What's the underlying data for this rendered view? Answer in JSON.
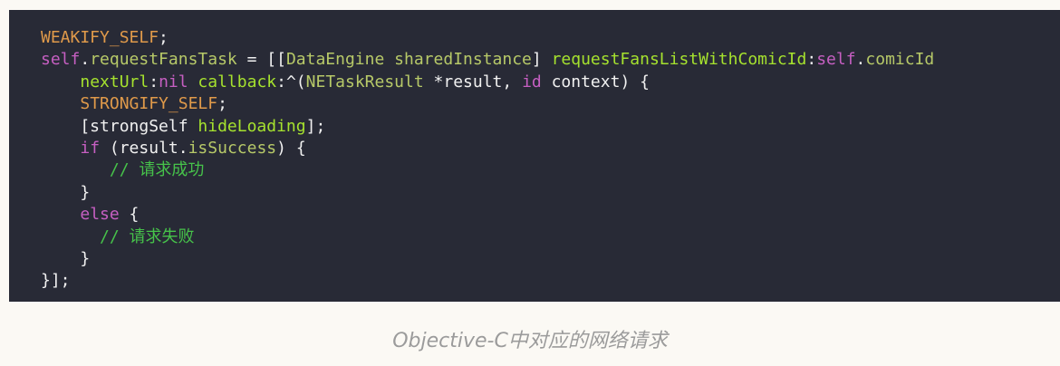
{
  "colors": {
    "background": "#282a36",
    "page": "#fbf9f4",
    "plain": "#f1f1f1",
    "macro": "#e09a4a",
    "keyword": "#c65fc2",
    "selector": "#a6e22e",
    "type": "#b7c968",
    "comment": "#46c24a",
    "caption": "#9b9b9b"
  },
  "code_lines": [
    {
      "tokens": [
        {
          "text": "WEAKIFY_SELF",
          "color": "#e09a4a"
        },
        {
          "text": ";",
          "color": "#f1f1f1"
        }
      ]
    },
    {
      "tokens": [
        {
          "text": "self",
          "color": "#c65fc2"
        },
        {
          "text": ".",
          "color": "#f1f1f1"
        },
        {
          "text": "requestFansTask",
          "color": "#b7c968"
        },
        {
          "text": " = [[",
          "color": "#f1f1f1"
        },
        {
          "text": "DataEngine",
          "color": "#b7c968"
        },
        {
          "text": " ",
          "color": "#f1f1f1"
        },
        {
          "text": "sharedInstance",
          "color": "#b7c968"
        },
        {
          "text": "] ",
          "color": "#f1f1f1"
        },
        {
          "text": "requestFansListWithComicId",
          "color": "#a6e22e"
        },
        {
          "text": ":",
          "color": "#f1f1f1"
        },
        {
          "text": "self",
          "color": "#c65fc2"
        },
        {
          "text": ".",
          "color": "#f1f1f1"
        },
        {
          "text": "comicId",
          "color": "#b7c968"
        }
      ]
    },
    {
      "tokens": [
        {
          "text": "    ",
          "color": "#f1f1f1"
        },
        {
          "text": "nextUrl",
          "color": "#a6e22e"
        },
        {
          "text": ":",
          "color": "#f1f1f1"
        },
        {
          "text": "nil",
          "color": "#c65fc2"
        },
        {
          "text": " ",
          "color": "#f1f1f1"
        },
        {
          "text": "callback",
          "color": "#a6e22e"
        },
        {
          "text": ":^(",
          "color": "#f1f1f1"
        },
        {
          "text": "NETaskResult",
          "color": "#b7c968"
        },
        {
          "text": " *result, ",
          "color": "#f1f1f1"
        },
        {
          "text": "id",
          "color": "#c65fc2"
        },
        {
          "text": " context) {",
          "color": "#f1f1f1"
        }
      ]
    },
    {
      "tokens": [
        {
          "text": "    ",
          "color": "#f1f1f1"
        },
        {
          "text": "STRONGIFY_SELF",
          "color": "#e09a4a"
        },
        {
          "text": ";",
          "color": "#f1f1f1"
        }
      ]
    },
    {
      "tokens": [
        {
          "text": "    [strongSelf ",
          "color": "#f1f1f1"
        },
        {
          "text": "hideLoading",
          "color": "#a6e22e"
        },
        {
          "text": "];",
          "color": "#f1f1f1"
        }
      ]
    },
    {
      "tokens": [
        {
          "text": "    ",
          "color": "#f1f1f1"
        },
        {
          "text": "if",
          "color": "#c65fc2"
        },
        {
          "text": " (result.",
          "color": "#f1f1f1"
        },
        {
          "text": "isSuccess",
          "color": "#b7c968"
        },
        {
          "text": ") {",
          "color": "#f1f1f1"
        }
      ]
    },
    {
      "tokens": [
        {
          "text": "       ",
          "color": "#f1f1f1"
        },
        {
          "text": "// 请求成功",
          "color": "#46c24a"
        }
      ]
    },
    {
      "tokens": [
        {
          "text": "    }",
          "color": "#f1f1f1"
        }
      ]
    },
    {
      "tokens": [
        {
          "text": "    ",
          "color": "#f1f1f1"
        },
        {
          "text": "else",
          "color": "#c65fc2"
        },
        {
          "text": " {",
          "color": "#f1f1f1"
        }
      ]
    },
    {
      "tokens": [
        {
          "text": "      ",
          "color": "#f1f1f1"
        },
        {
          "text": "// 请求失败",
          "color": "#46c24a"
        }
      ]
    },
    {
      "tokens": [
        {
          "text": "    }",
          "color": "#f1f1f1"
        }
      ]
    },
    {
      "tokens": [
        {
          "text": "}];",
          "color": "#f1f1f1"
        }
      ]
    }
  ],
  "caption": "Objective-C中对应的网络请求"
}
